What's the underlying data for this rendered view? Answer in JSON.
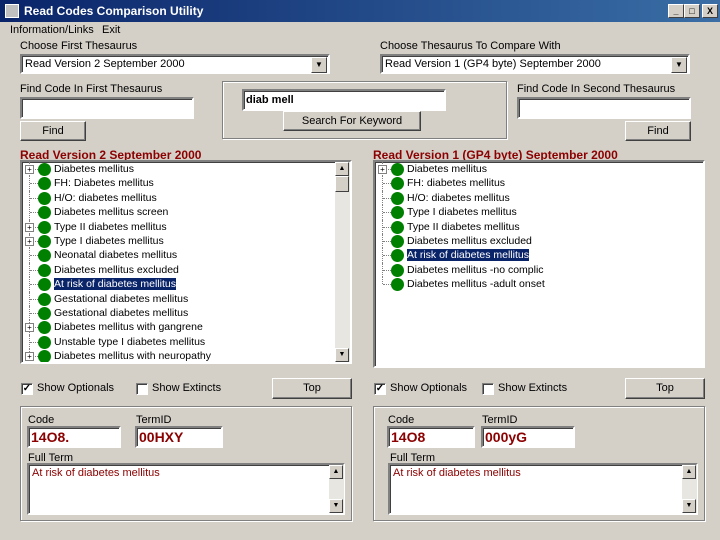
{
  "window": {
    "title": "Read Codes Comparison Utility",
    "min_glyph": "_",
    "max_glyph": "□",
    "close_glyph": "X"
  },
  "menu": [
    {
      "label": "Information/Links"
    },
    {
      "label": "Exit"
    }
  ],
  "first_thesaurus": {
    "label": "Choose First Thesaurus",
    "selected": "Read Version 2 September 2000"
  },
  "second_thesaurus": {
    "label": "Choose Thesaurus To Compare With",
    "selected": "Read Version 1 (GP4 byte) September 2000"
  },
  "find_first": {
    "label": "Find Code In First Thesaurus",
    "value": "",
    "button": "Find"
  },
  "keyword": {
    "value": "diab mell",
    "button": "Search For Keyword"
  },
  "find_second": {
    "label": "Find Code In Second Thesaurus",
    "value": "",
    "button": "Find"
  },
  "left_list": {
    "title": "Read Version 2 September 2000",
    "items": [
      {
        "label": "Diabetes mellitus",
        "expandable": true,
        "selected": false
      },
      {
        "label": "FH: Diabetes mellitus",
        "expandable": false,
        "selected": false
      },
      {
        "label": "H/O: diabetes mellitus",
        "expandable": false,
        "selected": false
      },
      {
        "label": "Diabetes mellitus screen",
        "expandable": false,
        "selected": false
      },
      {
        "label": "Type II diabetes mellitus",
        "expandable": true,
        "selected": false
      },
      {
        "label": "Type I diabetes mellitus",
        "expandable": true,
        "selected": false
      },
      {
        "label": "Neonatal diabetes mellitus",
        "expandable": false,
        "selected": false
      },
      {
        "label": "Diabetes mellitus excluded",
        "expandable": false,
        "selected": false
      },
      {
        "label": "At risk of diabetes mellitus",
        "expandable": false,
        "selected": true
      },
      {
        "label": "Gestational diabetes mellitus",
        "expandable": false,
        "selected": false
      },
      {
        "label": "Gestational diabetes mellitus",
        "expandable": false,
        "selected": false
      },
      {
        "label": "Diabetes mellitus with gangrene",
        "expandable": true,
        "selected": false
      },
      {
        "label": "Unstable type I diabetes mellitus",
        "expandable": false,
        "selected": false
      },
      {
        "label": "Diabetes mellitus with neuropathy",
        "expandable": true,
        "selected": false
      }
    ],
    "show_optionals_label": "Show Optionals",
    "show_optionals_checked": true,
    "show_extincts_label": "Show Extincts",
    "show_extincts_checked": false,
    "top_button": "Top"
  },
  "right_list": {
    "title": "Read Version 1 (GP4 byte) September 2000",
    "items": [
      {
        "label": "Diabetes mellitus",
        "expandable": true,
        "selected": false
      },
      {
        "label": "FH: diabetes mellitus",
        "expandable": false,
        "selected": false
      },
      {
        "label": "H/O: diabetes mellitus",
        "expandable": false,
        "selected": false
      },
      {
        "label": "Type I diabetes mellitus",
        "expandable": false,
        "selected": false
      },
      {
        "label": "Type II diabetes mellitus",
        "expandable": false,
        "selected": false
      },
      {
        "label": "Diabetes mellitus excluded",
        "expandable": false,
        "selected": false
      },
      {
        "label": "At risk of diabetes mellitus",
        "expandable": false,
        "selected": true
      },
      {
        "label": "Diabetes mellitus -no complic",
        "expandable": false,
        "selected": false
      },
      {
        "label": "Diabetes mellitus -adult onset",
        "expandable": false,
        "selected": false
      }
    ],
    "show_optionals_label": "Show Optionals",
    "show_optionals_checked": true,
    "show_extincts_label": "Show Extincts",
    "show_extincts_checked": false,
    "top_button": "Top"
  },
  "left_detail": {
    "code_label": "Code",
    "code": "14O8.",
    "termid_label": "TermID",
    "termid": "00HXY",
    "fullterm_label": "Full Term",
    "fullterm": "At risk of diabetes mellitus"
  },
  "right_detail": {
    "code_label": "Code",
    "code": "14O8",
    "termid_label": "TermID",
    "termid": "000yG",
    "fullterm_label": "Full Term",
    "fullterm": "At risk of diabetes mellitus"
  },
  "colors": {
    "title_bar": "#0a246a",
    "list_title": "#8b0000",
    "tree_dot": "#008000",
    "selection": "#0a246a"
  }
}
